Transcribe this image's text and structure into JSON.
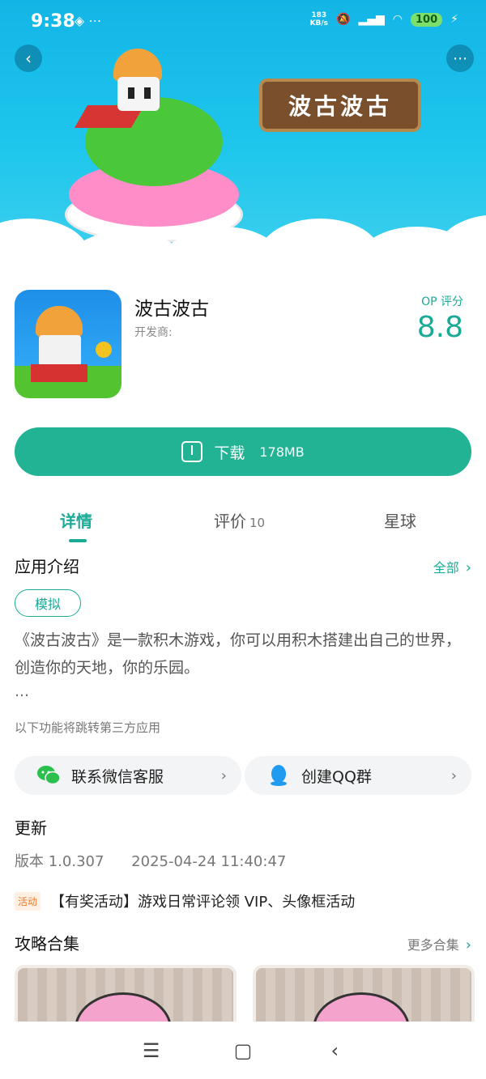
{
  "status_bar": {
    "time": "9:38",
    "speed_value": "183",
    "speed_unit": "KB/s",
    "battery": "100"
  },
  "hero": {
    "logo_text": "波古波古"
  },
  "app": {
    "name": "波古波古",
    "developer_label": "开发商:",
    "score_label": "OP 评分",
    "score": "8.8",
    "download_label": "下载",
    "download_size": "178MB"
  },
  "tabs": [
    {
      "label": "详情"
    },
    {
      "label": "评价",
      "count": "10"
    },
    {
      "label": "星球"
    }
  ],
  "intro": {
    "title": "应用介绍",
    "more": "全部",
    "tag": "模拟",
    "description": "《波古波古》是一款积木游戏，你可以用积木搭建出自己的世界，创造你的天地，你的乐园。",
    "ellipsis": "…",
    "note": "以下功能将跳转第三方应用"
  },
  "services": [
    {
      "label": "联系微信客服",
      "icon": "wechat-icon"
    },
    {
      "label": "创建QQ群",
      "icon": "qq-icon"
    }
  ],
  "update": {
    "title": "更新",
    "version": "版本 1.0.307",
    "date": "2025-04-24 11:40:47"
  },
  "activity": {
    "badge": "活动",
    "text": "【有奖活动】游戏日常评论领 VIP、头像框活动"
  },
  "guides": {
    "title": "攻略合集",
    "more": "更多合集"
  },
  "colors": {
    "accent": "#21b394",
    "hero_top": "#13b5e6"
  }
}
